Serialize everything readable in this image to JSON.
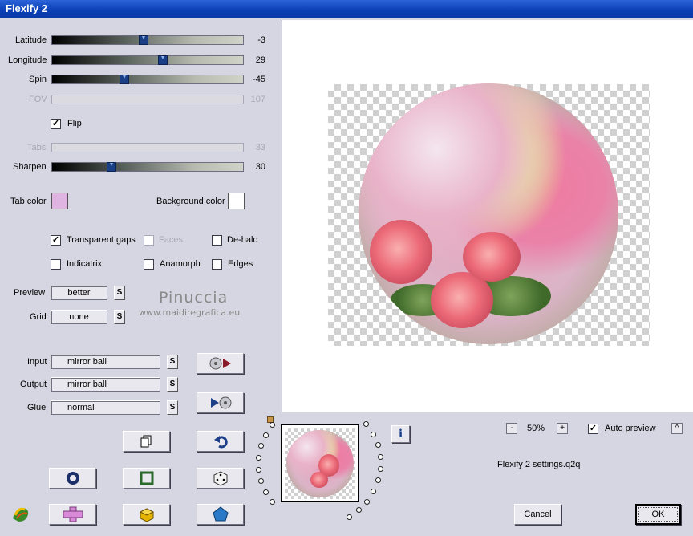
{
  "window": {
    "title": "Flexify 2"
  },
  "sliders": [
    {
      "name": "latitude",
      "label": "Latitude",
      "value": "-3",
      "position": 0.49,
      "enabled": true
    },
    {
      "name": "longitude",
      "label": "Longitude",
      "value": "29",
      "position": 0.58,
      "enabled": true
    },
    {
      "name": "spin",
      "label": "Spin",
      "value": "-45",
      "position": 0.38,
      "enabled": true
    },
    {
      "name": "fov",
      "label": "FOV",
      "value": "107",
      "enabled": false
    },
    {
      "name": "tabs",
      "label": "Tabs",
      "value": "33",
      "enabled": false
    },
    {
      "name": "sharpen",
      "label": "Sharpen",
      "value": "30",
      "position": 0.31,
      "enabled": true
    }
  ],
  "flip": {
    "label": "Flip",
    "checked": true
  },
  "tab_color": {
    "label": "Tab color",
    "color": "#e0b4e0"
  },
  "background_color": {
    "label": "Background color",
    "color": "#ffffff"
  },
  "options": [
    {
      "name": "transparent-gaps",
      "label": "Transparent gaps",
      "checked": true,
      "enabled": true
    },
    {
      "name": "faces",
      "label": "Faces",
      "checked": false,
      "enabled": false
    },
    {
      "name": "de-halo",
      "label": "De-halo",
      "checked": false,
      "enabled": true
    },
    {
      "name": "indicatrix",
      "label": "Indicatrix",
      "checked": false,
      "enabled": true
    },
    {
      "name": "anamorph",
      "label": "Anamorph",
      "checked": false,
      "enabled": true
    },
    {
      "name": "edges",
      "label": "Edges",
      "checked": false,
      "enabled": true
    }
  ],
  "preview": {
    "label": "Preview",
    "value": "better"
  },
  "grid": {
    "label": "Grid",
    "value": "none"
  },
  "input": {
    "label": "Input",
    "value": "mirror ball"
  },
  "output": {
    "label": "Output",
    "value": "mirror ball"
  },
  "glue": {
    "label": "Glue",
    "value": "normal"
  },
  "s_label": "S",
  "watermark": {
    "line1": "Pinuccia",
    "line2": "www.maidiregrafica.eu"
  },
  "zoom": {
    "minus": "-",
    "value": "50%",
    "plus": "+"
  },
  "auto_preview": {
    "label": "Auto preview",
    "checked": true,
    "arrow": "^"
  },
  "settings_file": "Flexify 2 settings.q2q",
  "cancel_label": "Cancel",
  "ok_label": "OK",
  "info_label": "i",
  "icons": [
    "play-forward-icon",
    "play-back-icon",
    "copy-icon",
    "undo-icon",
    "circle-icon",
    "square-icon",
    "dice-icon",
    "cross-icon",
    "cube-icon",
    "pentagon-icon",
    "flexify-logo-icon"
  ]
}
